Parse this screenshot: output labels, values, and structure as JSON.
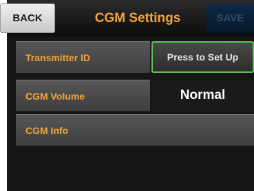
{
  "header": {
    "back_label": "BACK",
    "title": "CGM Settings",
    "save_label": "SAVE"
  },
  "rows": [
    {
      "label": "Transmitter ID",
      "value": "Press to Set Up"
    },
    {
      "label": "CGM Volume",
      "value": "Normal"
    },
    {
      "label": "CGM Info"
    }
  ],
  "colors": {
    "accent": "#f2a43c",
    "highlight_border": "#5cc45c",
    "save_disabled": "#2d4c6c"
  }
}
